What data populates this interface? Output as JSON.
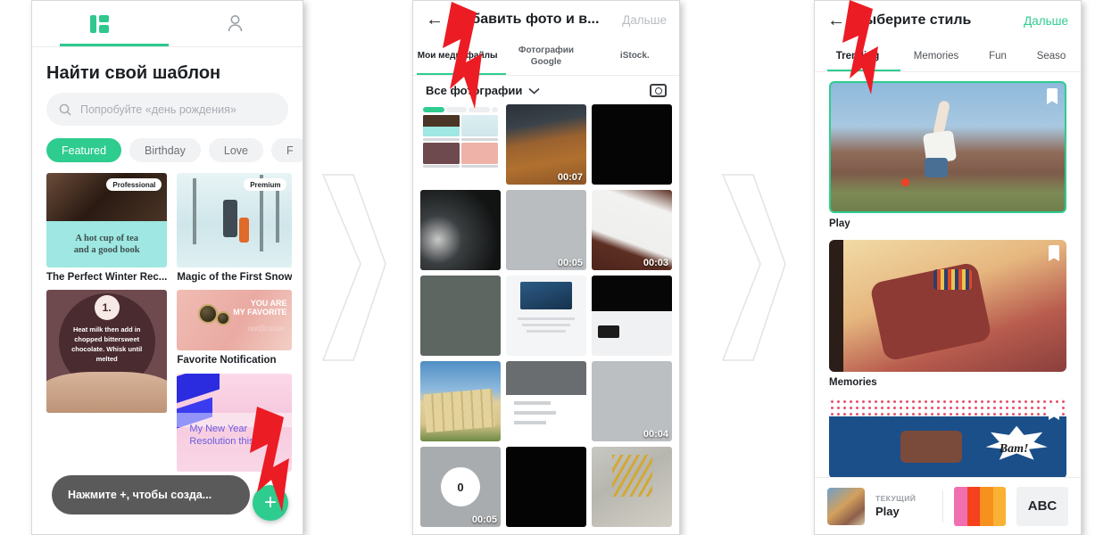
{
  "panel1": {
    "tabs": [
      {
        "name": "templates-tab",
        "icon": "grid-icon",
        "active": true
      },
      {
        "name": "profile-tab",
        "icon": "person-icon",
        "active": false
      }
    ],
    "title": "Найти свой шаблон",
    "search": {
      "placeholder": "Попробуйте «день рождения»",
      "icon": "search-icon"
    },
    "chips": [
      {
        "label": "Featured",
        "active": true
      },
      {
        "label": "Birthday",
        "active": false
      },
      {
        "label": "Love",
        "active": false
      },
      {
        "label": "F",
        "active": false
      }
    ],
    "templates": [
      {
        "caption": "The Perfect Winter Rec...",
        "badge": "Professional",
        "art_line1": "A hot cup of tea",
        "art_line2": "and a good book"
      },
      {
        "caption": "Magic of the First Snow",
        "badge": "Premium"
      },
      {
        "caption": "",
        "number": "1.",
        "art_text": "Heat milk then add in chopped bittersweet chocolate. Whisk until melted"
      },
      {
        "caption": "Favorite Notification",
        "art_line1": "YOU ARE",
        "art_line2": "MY FAVORITE",
        "art_line3": "notification"
      },
      {
        "caption": "",
        "art_line1": "My New Year",
        "art_line2": "Resolution this"
      }
    ],
    "toast": "Нажмите +, чтобы созда...",
    "fab": {
      "label": "+",
      "color": "#2ecc8f"
    }
  },
  "panel2": {
    "header": {
      "back": "←",
      "title": "Добавить фото и в...",
      "next": "Дальше",
      "next_enabled": false
    },
    "tabs": [
      {
        "label": "Мои медиафайлы",
        "active": true
      },
      {
        "label": "Фотографии Google",
        "active": false
      },
      {
        "label": "iStock.",
        "active": false
      }
    ],
    "filter": {
      "label": "Все фотографии",
      "chevron": "chevron-down-icon",
      "camera": "camera-icon"
    },
    "photos": [
      {
        "kind": "app-screenshot",
        "duration": ""
      },
      {
        "kind": "desk-stylus",
        "duration": "00:07"
      },
      {
        "kind": "black",
        "duration": ""
      },
      {
        "kind": "dark-streak",
        "duration": ""
      },
      {
        "kind": "gray-flat",
        "duration": "00:05"
      },
      {
        "kind": "paper-desk",
        "duration": "00:03"
      },
      {
        "kind": "gray-green",
        "duration": ""
      },
      {
        "kind": "doc-card",
        "duration": ""
      },
      {
        "kind": "black-strip",
        "duration": ""
      },
      {
        "kind": "building-sky",
        "duration": ""
      },
      {
        "kind": "dialog-sheet",
        "duration": ""
      },
      {
        "kind": "gray-flat2",
        "duration": "00:04"
      },
      {
        "kind": "burst-badge",
        "duration": "00:05",
        "badge": "0"
      },
      {
        "kind": "black-grid",
        "duration": ""
      },
      {
        "kind": "insect-macro",
        "duration": ""
      }
    ]
  },
  "panel3": {
    "header": {
      "back": "←",
      "title": "Выберите стиль",
      "next": "Дальше",
      "next_enabled": true
    },
    "tabs": [
      {
        "label": "Trending",
        "active": true
      },
      {
        "label": "Memories",
        "active": false
      },
      {
        "label": "Fun",
        "active": false
      },
      {
        "label": "Seaso",
        "active": false
      }
    ],
    "styles": [
      {
        "name": "Play",
        "selected": true,
        "bookmark": true
      },
      {
        "name": "Memories",
        "selected": false,
        "bookmark": true
      },
      {
        "name": "",
        "selected": false,
        "bookmark": true,
        "art_text": "Bam!"
      }
    ],
    "bottom": {
      "label": "ТЕКУЩИЙ",
      "value": "Play",
      "palette": [
        "#ef6fb0",
        "#f5411e",
        "#f6911e",
        "#f9b233"
      ],
      "abc": "ABC"
    }
  },
  "decor": {
    "chevron_color": "#ffffff",
    "bolt_color": "#ec1c24",
    "accent": "#2ecc8f"
  }
}
